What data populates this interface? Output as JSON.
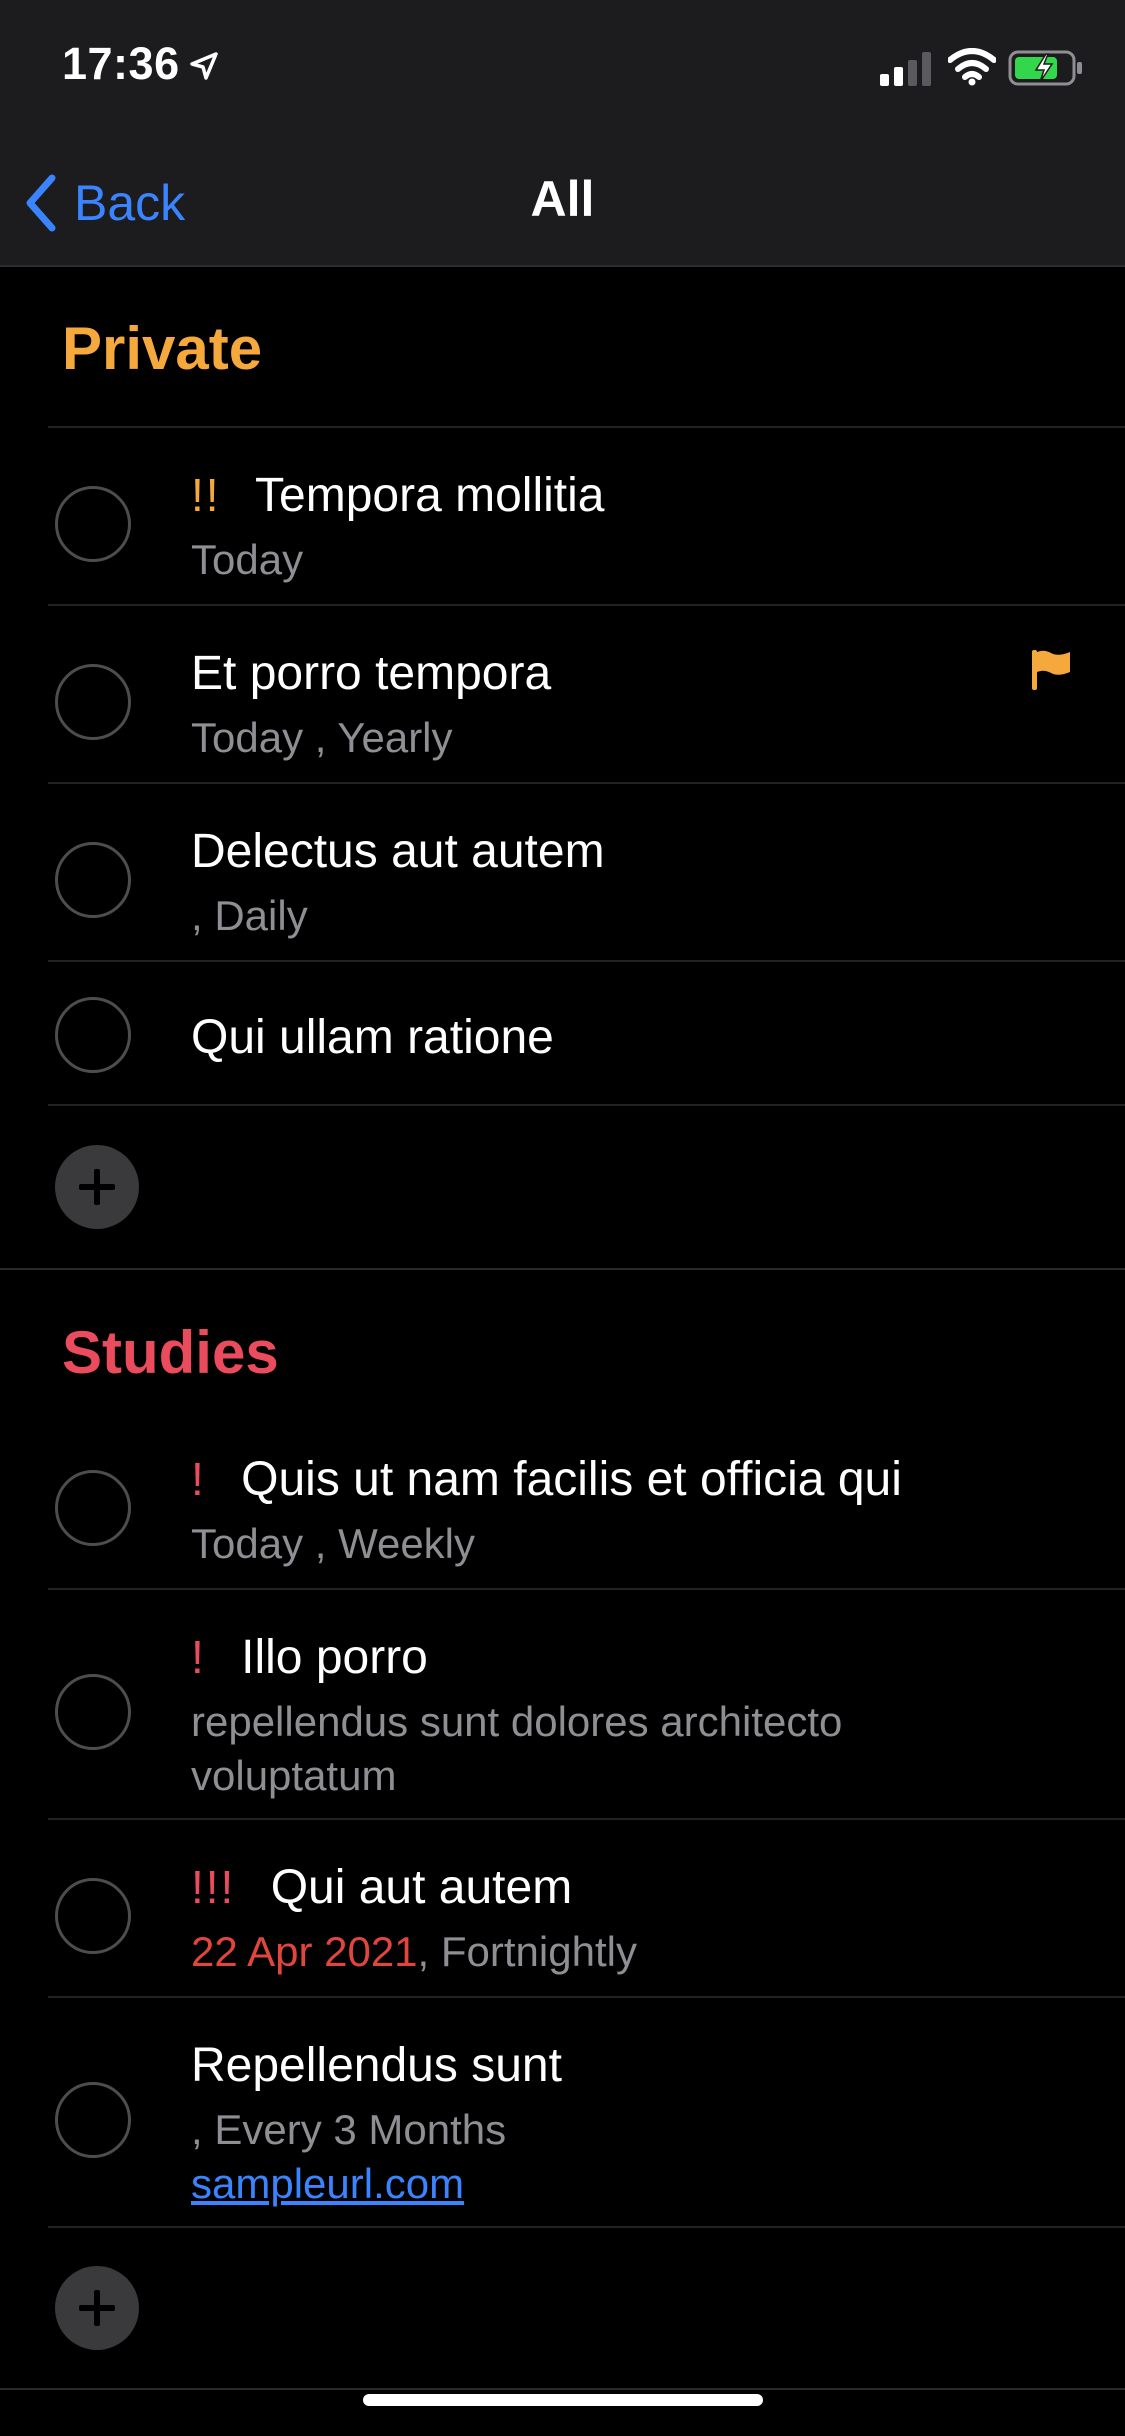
{
  "status_bar": {
    "time": "17:36"
  },
  "nav": {
    "back_label": "Back",
    "title": "All"
  },
  "colors": {
    "private": "#f5a83c",
    "studies": "#ea4c5e",
    "accent": "#3a84ff",
    "overdue": "#e0463d"
  },
  "sections": [
    {
      "title": "Private",
      "items": [
        {
          "priority": "!!",
          "title": "Tempora mollitia",
          "subtitle": "Today"
        },
        {
          "priority": "",
          "title": "Et porro tempora",
          "subtitle": "Today , Yearly",
          "flagged": true
        },
        {
          "priority": "",
          "title": "Delectus aut autem",
          "subtitle": ", Daily"
        },
        {
          "priority": "",
          "title": "Qui ullam ratione",
          "subtitle": ""
        }
      ]
    },
    {
      "title": "Studies",
      "items": [
        {
          "priority": "!",
          "title": "Quis ut nam facilis et officia qui",
          "subtitle": "Today , Weekly"
        },
        {
          "priority": "!",
          "title": "Illo porro",
          "subtitle_line1": "repellendus sunt dolores architecto",
          "subtitle_line2": "voluptatum"
        },
        {
          "priority": "!!!",
          "title": "Qui aut autem",
          "subtitle_date": "22 Apr 2021",
          "subtitle_rest": ", Fortnightly"
        },
        {
          "priority": "",
          "title": "Repellendus sunt",
          "subtitle": ", Every 3 Months",
          "link": "sampleurl.com"
        }
      ]
    }
  ]
}
